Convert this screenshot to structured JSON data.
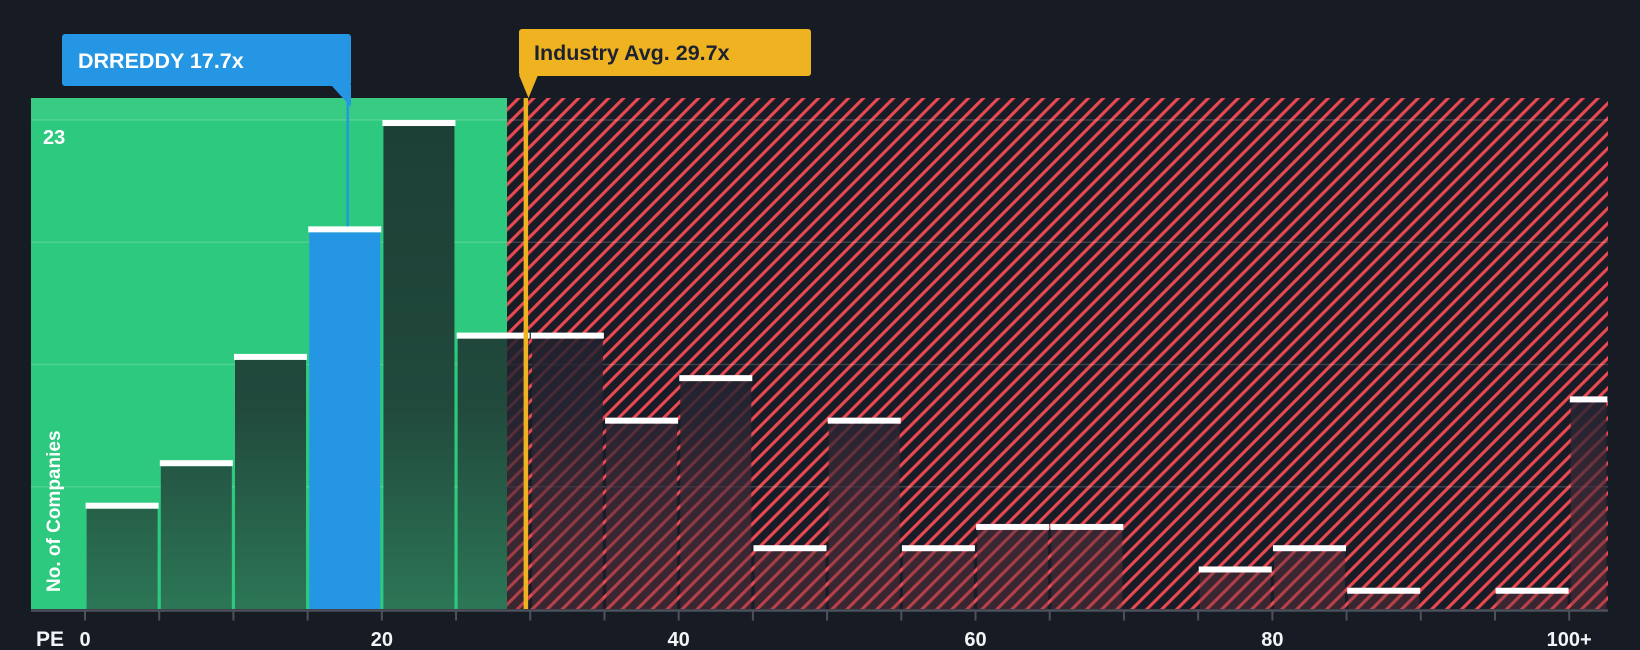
{
  "colors": {
    "background": "#161b24",
    "green_zone": "#2dc97e",
    "hatch_background": "#181c27",
    "hatch_red": "#e94951",
    "company_blue": "#2496e4",
    "industry_amber": "#efb221",
    "cap_white": "#ffffff",
    "axis_grey": "#4c515b",
    "label_white": "#f2f4f6",
    "tooltip_dark_text": "#1c2230"
  },
  "tooltips": {
    "company": {
      "label": "DRREDDY 17.7x"
    },
    "industry": {
      "label": "Industry Avg. 29.7x"
    }
  },
  "axis": {
    "x_title": "PE",
    "x_tick_labels": [
      "0",
      "20",
      "40",
      "60",
      "80",
      "100+"
    ],
    "x_tick_values": [
      0,
      20,
      40,
      60,
      80,
      100
    ],
    "y_label": "No. of Companies",
    "y_max_label": "23"
  },
  "chart_data": {
    "type": "bar",
    "title": "",
    "xlabel": "PE",
    "ylabel": "No. of Companies",
    "ylim": [
      0,
      23
    ],
    "grid_divisions": 4,
    "legend": "none",
    "categories": [
      "0-5",
      "5-10",
      "10-15",
      "15-20",
      "20-25",
      "25-30",
      "30-35",
      "35-40",
      "40-45",
      "45-50",
      "50-55",
      "55-60",
      "60-65",
      "65-70",
      "70-75",
      "75-80",
      "80-85",
      "85-90",
      "90-95",
      "95-100",
      "100+"
    ],
    "values": [
      5,
      7,
      12,
      18,
      23,
      13,
      13,
      9,
      11,
      3,
      9,
      3,
      4,
      4,
      0,
      2,
      3,
      1,
      0,
      1,
      10
    ],
    "bucket_size": 5,
    "highlight": {
      "company": "DRREDDY",
      "pe": 17.7,
      "category": "15-20",
      "color": "#2496e4"
    },
    "industry_avg": {
      "value": 29.7,
      "color": "#efb221"
    },
    "regions": [
      {
        "name": "below-industry-average",
        "style": "solid-green",
        "to_pe": 28.4
      },
      {
        "name": "above-industry-average",
        "style": "red-diagonal-hatch",
        "from_pe": 28.4
      }
    ]
  }
}
